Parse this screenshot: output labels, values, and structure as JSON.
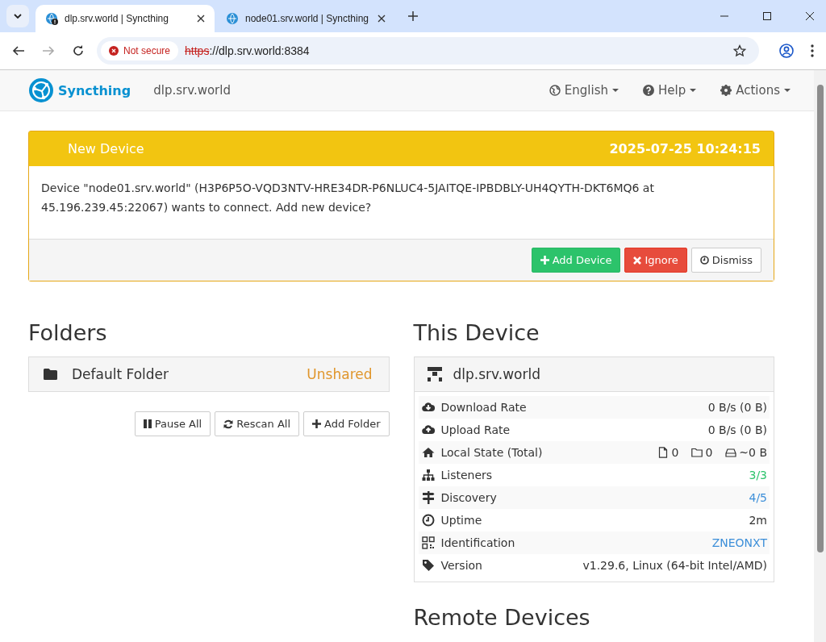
{
  "browser": {
    "tabs": [
      {
        "title": "dlp.srv.world | Syncthing",
        "selected": true,
        "warning": true
      },
      {
        "title": "node01.srv.world | Syncthing",
        "selected": false,
        "warning": false
      }
    ],
    "security_label": "Not secure",
    "url_scheme": "https",
    "url_rest": "://dlp.srv.world:8384"
  },
  "navbar": {
    "brand": "Syncthing",
    "device_name": "dlp.srv.world",
    "menus": [
      {
        "kind": "language",
        "label": "English"
      },
      {
        "kind": "help",
        "label": "Help"
      },
      {
        "kind": "actions",
        "label": "Actions"
      }
    ]
  },
  "notice": {
    "title": "New Device",
    "time": "2025-07-25 10:24:15",
    "message": "Device \"node01.srv.world\" (H3P6P5O-VQD3NTV-HRE34DR-P6NLUC4-5JAITQE-IPBDBLY-UH4QYTH-DKT6MQ6 at 45.196.239.45:22067) wants to connect. Add new device?",
    "buttons": [
      {
        "kind": "add",
        "label": "Add Device"
      },
      {
        "kind": "ignore",
        "label": "Ignore"
      },
      {
        "kind": "dismiss",
        "label": "Dismiss"
      }
    ]
  },
  "folders": {
    "heading": "Folders",
    "items": [
      {
        "name": "Default Folder",
        "status": "Unshared"
      }
    ],
    "buttons": [
      {
        "kind": "pause",
        "label": "Pause All"
      },
      {
        "kind": "rescan",
        "label": "Rescan All"
      },
      {
        "kind": "add",
        "label": "Add Folder"
      }
    ]
  },
  "this_device": {
    "heading": "This Device",
    "name": "dlp.srv.world",
    "rows": [
      {
        "kind": "download",
        "label": "Download Rate",
        "value": "0 B/s (0 B)"
      },
      {
        "kind": "upload",
        "label": "Upload Rate",
        "value": "0 B/s (0 B)"
      },
      {
        "kind": "local_state",
        "label": "Local State (Total)",
        "parts": [
          {
            "kind": "files",
            "text": "0"
          },
          {
            "kind": "folders",
            "text": "0"
          },
          {
            "kind": "size",
            "text": "~0 B"
          }
        ]
      },
      {
        "kind": "listeners",
        "label": "Listeners",
        "value": "3/3",
        "color": "#2cc36b"
      },
      {
        "kind": "discovery",
        "label": "Discovery",
        "value": "4/5",
        "color": "#3d8fd9"
      },
      {
        "kind": "uptime",
        "label": "Uptime",
        "value": "2m"
      },
      {
        "kind": "identification",
        "label": "Identification",
        "value": "ZNEONXT",
        "color": "#3d8fd9"
      },
      {
        "kind": "version",
        "label": "Version",
        "value": "v1.29.6, Linux (64-bit Intel/AMD)"
      }
    ]
  },
  "remote_devices": {
    "heading": "Remote Devices"
  }
}
